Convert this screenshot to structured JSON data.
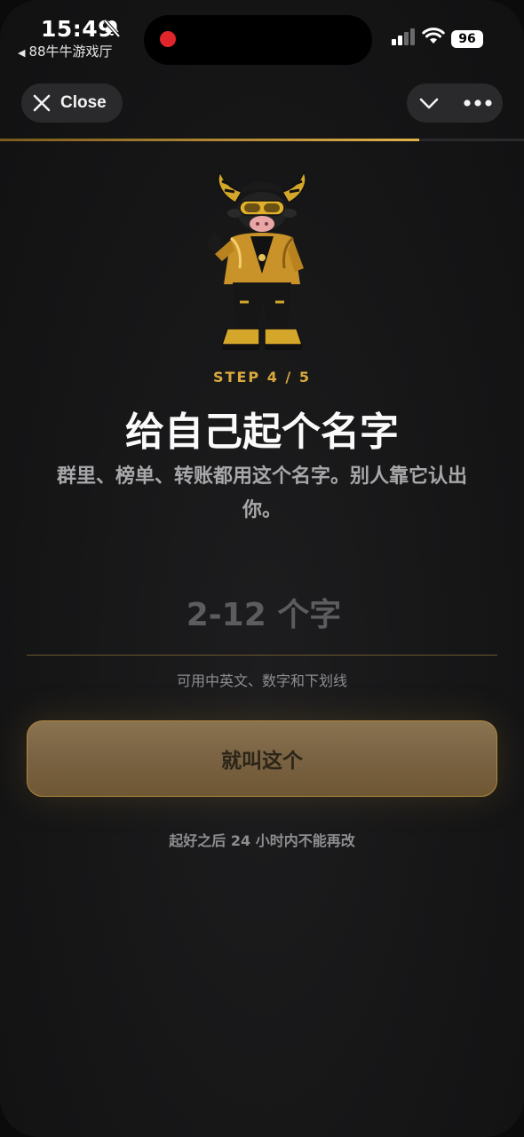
{
  "status_bar": {
    "time": "15:49",
    "back_app": "88牛牛游戏厅",
    "battery": "96",
    "recording_color": "#e0262b"
  },
  "toolbar": {
    "close_label": "Close",
    "close_icon": "close-icon",
    "collapse_icon": "chevron-down-icon",
    "more_icon": "more-dots-icon"
  },
  "progress": {
    "current": 4,
    "total": 5,
    "fill_fraction": 0.8
  },
  "onboarding": {
    "step_label": "STEP 4 / 5",
    "title": "给自己起个名字",
    "description": "群里、榜单、转账都用这个名字。别人靠它认出你。",
    "name_input": {
      "value": "",
      "placeholder": "2-12 个字"
    },
    "hint": "可用中英文、数字和下划线",
    "confirm_label": "就叫这个",
    "note": "起好之后 24 小时内不能再改"
  },
  "colors": {
    "accent_gold": "#d9a93c",
    "button_gold": "#7b6444",
    "background": "#161617"
  }
}
